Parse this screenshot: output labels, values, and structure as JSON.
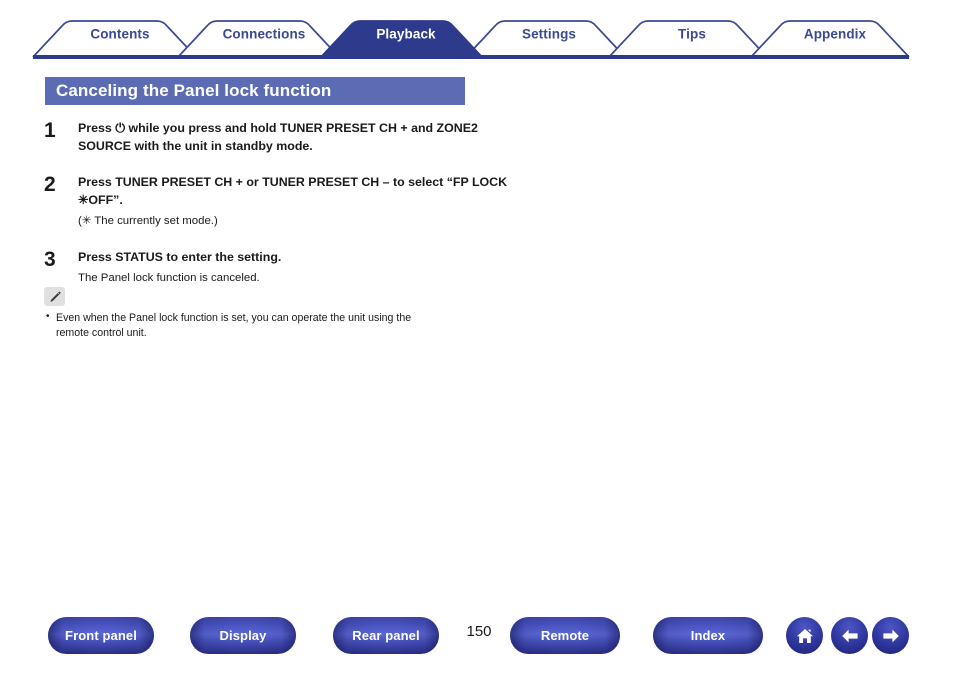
{
  "tabs": [
    {
      "label": "Contents",
      "active": false
    },
    {
      "label": "Connections",
      "active": false
    },
    {
      "label": "Playback",
      "active": true
    },
    {
      "label": "Settings",
      "active": false
    },
    {
      "label": "Tips",
      "active": false
    },
    {
      "label": "Appendix",
      "active": false
    }
  ],
  "heading": {
    "title": "Canceling the Panel lock function"
  },
  "steps": [
    {
      "number": "1",
      "title": "Press ⏻ while you press and hold TUNER PRESET CH + and ZONE2 SOURCE with the unit in standby mode.",
      "sub": ""
    },
    {
      "number": "2",
      "title": "Press TUNER PRESET CH + or TUNER PRESET CH – to select “FP LOCK ✳OFF”.",
      "sub": "(✳ The currently set mode.)"
    },
    {
      "number": "3",
      "title": "Press STATUS to enter the setting.",
      "sub": "The Panel lock function is canceled."
    }
  ],
  "note": {
    "icon": "pencil-icon",
    "items": [
      "Even when the Panel lock function is set, you can operate the unit using the remote control unit."
    ]
  },
  "footer": {
    "buttons": [
      {
        "label": "Front panel"
      },
      {
        "label": "Display"
      },
      {
        "label": "Rear panel"
      },
      {
        "label": "Remote"
      },
      {
        "label": "Index"
      }
    ],
    "page_number": "150",
    "nav_icons": [
      {
        "name": "home-icon"
      },
      {
        "name": "arrow-left-icon"
      },
      {
        "name": "arrow-right-icon"
      }
    ]
  },
  "colors": {
    "accent_blue": "#3b4896",
    "heading_bar": "#5b6cb4",
    "active_tab": "#2e3a8c",
    "button_blue": "#3139a2"
  }
}
